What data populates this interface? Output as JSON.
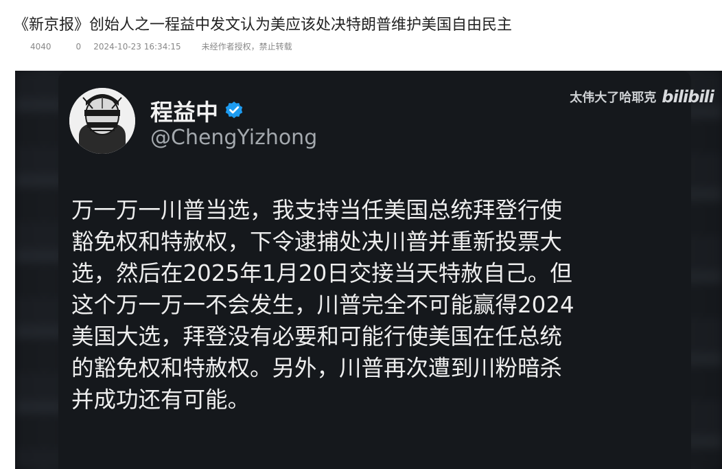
{
  "article": {
    "title": "《新京报》创始人之一程益中发文认为美应该处决特朗普维护美国自由民主",
    "views": "4040",
    "comments": "0",
    "date": "2024-10-23 16:34:15",
    "copyright": "未经作者授权，禁止转载"
  },
  "tweet": {
    "display_name": "程益中",
    "handle": "@ChengYizhong",
    "lines": [
      "万一万一川普当选，我支持当任美国总统拜登行使",
      "豁免权和特赦权，下令逮捕处决川普并重新投票大",
      "选，然后在2025年1月20日交接当天特赦自己。但",
      "这个万一万一不会发生，川普完全不可能赢得2024",
      "美国大选，拜登没有必要和可能行使美国在任总统",
      "的豁免权和特赦权。另外，川普再次遭到川粉暗杀",
      "并成功还有可能。"
    ]
  },
  "watermark": {
    "text": "太伟大了哈耶克",
    "logo": "bilibili"
  },
  "icons": {
    "verified": "verified-badge-icon",
    "avatar": "avatar-image"
  },
  "colors": {
    "background_dark": "#15181c",
    "verified_blue": "#1d9bf0",
    "text_light": "#eeeeee",
    "handle_gray": "#a4a9ae",
    "meta_gray": "#888888"
  }
}
